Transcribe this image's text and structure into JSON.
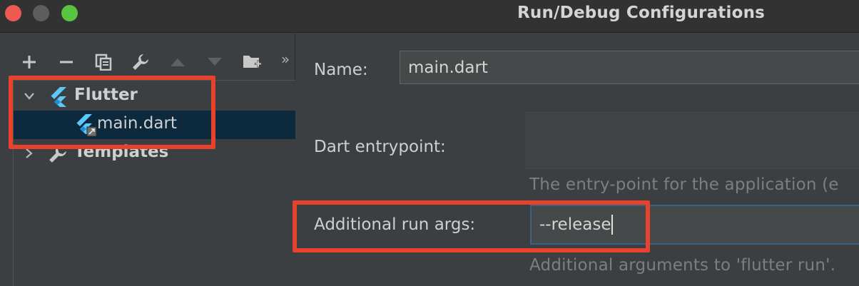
{
  "window": {
    "title": "Run/Debug Configurations"
  },
  "toolbar": {
    "buttons": [
      {
        "icon": "add-icon"
      },
      {
        "icon": "remove-icon"
      },
      {
        "icon": "copy-icon"
      },
      {
        "icon": "wrench-icon"
      },
      {
        "icon": "move-up-icon"
      },
      {
        "icon": "move-down-icon"
      },
      {
        "icon": "new-folder-icon"
      },
      {
        "icon": "more-chevrons-icon"
      }
    ],
    "more_label": "»"
  },
  "tree": {
    "items": [
      {
        "label": "Flutter",
        "icon": "flutter-icon",
        "expanded": true
      },
      {
        "label": "main.dart",
        "icon": "flutter-run-config-icon",
        "selected": true
      },
      {
        "label": "Templates",
        "icon": "wrench-icon",
        "expanded": false
      }
    ]
  },
  "form": {
    "name_label": "Name:",
    "name_value": "main.dart",
    "entrypoint_label": "Dart entrypoint:",
    "entrypoint_value": "",
    "entrypoint_hint": "The entry-point for the application (e",
    "args_label": "Additional run args:",
    "args_value": "--release",
    "args_hint": "Additional arguments to 'flutter run'."
  },
  "colors": {
    "annotation": "#e8412c",
    "selection": "#0d293e",
    "focus_border": "#3d6185",
    "flutter_blue": "#5cc8f8",
    "flutter_dark": "#1d8fd6"
  }
}
